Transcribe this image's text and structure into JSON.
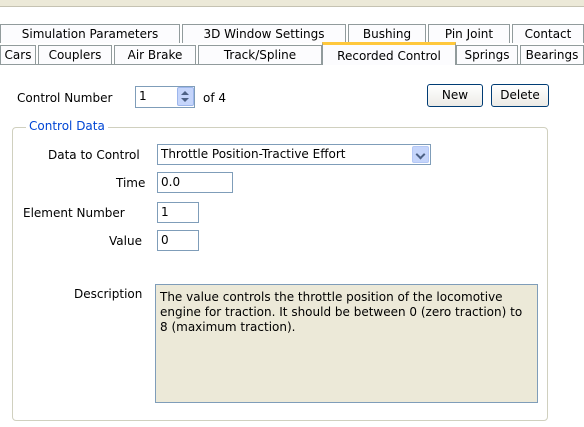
{
  "tabs": {
    "row1": [
      "Simulation Parameters",
      "3D Window Settings",
      "Bushing",
      "Pin Joint",
      "Contact"
    ],
    "row2": [
      "Cars",
      "Couplers",
      "Air Brake",
      "Track/Spline",
      "Recorded Control",
      "Springs",
      "Bearings"
    ],
    "active": "Recorded Control"
  },
  "control": {
    "number_label": "Control Number",
    "number_value": "1",
    "of_text": "of 4",
    "new_label": "New",
    "delete_label": "Delete"
  },
  "group": {
    "title": "Control Data",
    "data_to_control_label": "Data to Control",
    "data_to_control_value": "Throttle Position-Tractive Effort",
    "time_label": "Time",
    "time_value": "0.0",
    "element_label": "Element Number",
    "element_value": "1",
    "value_label": "Value",
    "value_value": "0",
    "description_label": "Description",
    "description_text": "The value controls the throttle position of the locomotive engine for traction. It should be between 0 (zero traction) to 8 (maximum traction)."
  }
}
